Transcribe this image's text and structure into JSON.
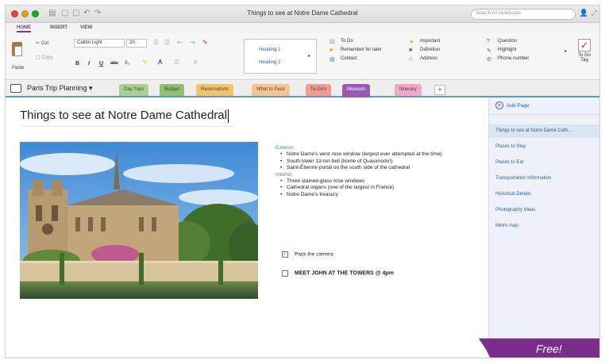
{
  "window": {
    "title": "Things to see at Notre Dame Cathedral"
  },
  "search": {
    "placeholder": "Search All Notebooks"
  },
  "ribbon_tabs": [
    "HOME",
    "INSERT",
    "VIEW"
  ],
  "ribbon": {
    "paste": "Paste",
    "cut": "Cut",
    "copy": "Copy",
    "font": "Calibri Light",
    "size": "20",
    "bold": "B",
    "italic": "I",
    "underline": "U",
    "strike": "abc",
    "subscript": "X₂",
    "styles": [
      "Heading 1",
      "Heading 2"
    ],
    "tags": [
      {
        "label": "To Do",
        "icon": "☑",
        "color": "#c0392b"
      },
      {
        "label": "Remember for later",
        "icon": "■",
        "color": "#e6b800"
      },
      {
        "label": "Contact",
        "icon": "▤",
        "color": "#3a6fb0"
      },
      {
        "label": "Important",
        "icon": "★",
        "color": "#e6b800"
      },
      {
        "label": "Definition",
        "icon": "■",
        "color": "#2e9b3b"
      },
      {
        "label": "Address",
        "icon": "⌂",
        "color": "#555555"
      },
      {
        "label": "Question",
        "icon": "?",
        "color": "#7a3b8c"
      },
      {
        "label": "Highlight",
        "icon": "✎",
        "color": "#555555"
      },
      {
        "label": "Phone number",
        "icon": "✆",
        "color": "#555555"
      }
    ],
    "todo_tag": "To Do Tag"
  },
  "notebook": {
    "title": "Paris Trip Planning"
  },
  "sections": [
    {
      "label": "Day Trips",
      "color": "#a9d08e"
    },
    {
      "label": "Budget",
      "color": "#8dc26f"
    },
    {
      "label": "Reservations",
      "color": "#f4c26b"
    },
    {
      "label": "What to Pack",
      "color": "#f6c58d"
    },
    {
      "label": "To-Do's",
      "color": "#f29b8f"
    },
    {
      "label": "Museum",
      "color": "#9b59b6"
    },
    {
      "label": "Itinerary",
      "color": "#f2a7c3"
    }
  ],
  "page": {
    "title": "Things to see at Notre Dame Cathedral",
    "exterior_label": "Exterior:",
    "exterior": [
      "Notre Dame's west rose window (largest ever attempted at the time)",
      "South tower 13-ton bell (home of Quasimodo!)",
      "Saint-Étienne portal on the south side of the cathedral"
    ],
    "interior_label": "Interior:",
    "interior": [
      "Three stained-glass rose windows",
      "Cathedral organs (one of the largest in France)",
      "Notre Dame's treasury"
    ],
    "todo_1": "Pack the camera",
    "todo_2": "MEET JOHN AT THE TOWERS @ 4pm"
  },
  "pages_panel": {
    "add_page": "Add Page",
    "items": [
      "Things to see at Notre Dame Cath...",
      "Places to Stay",
      "Places to Eat",
      "Transportation Information",
      "Historical Details",
      "Photography Ideas",
      "Metro map"
    ]
  },
  "banner": {
    "text": "Free!"
  }
}
